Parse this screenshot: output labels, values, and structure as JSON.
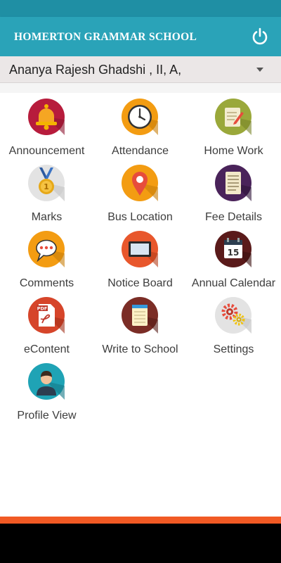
{
  "app": {
    "title": "HOMERTON GRAMMAR SCHOOL"
  },
  "student_selector": {
    "selected": "Ananya Rajesh Ghadshi , II, A,"
  },
  "menu": [
    {
      "label": "Announcement",
      "icon": "bell-icon"
    },
    {
      "label": "Attendance",
      "icon": "clock-icon"
    },
    {
      "label": "Home Work",
      "icon": "notepad-pencil-icon"
    },
    {
      "label": "Marks",
      "icon": "medal-icon"
    },
    {
      "label": "Bus Location",
      "icon": "map-pin-icon"
    },
    {
      "label": "Fee Details",
      "icon": "receipt-icon"
    },
    {
      "label": "Comments",
      "icon": "speech-bubble-icon"
    },
    {
      "label": "Notice Board",
      "icon": "screen-board-icon"
    },
    {
      "label": "Annual Calendar",
      "icon": "calendar-icon"
    },
    {
      "label": "eContent",
      "icon": "pdf-icon"
    },
    {
      "label": "Write to School",
      "icon": "notebook-icon"
    },
    {
      "label": "Settings",
      "icon": "gears-icon"
    },
    {
      "label": "Profile View",
      "icon": "user-avatar-icon"
    }
  ],
  "calendar_day": "15",
  "pdf_text": "PDF",
  "colors": {
    "app_bar": "#2aa3b8",
    "status_bar": "#1f8fa4",
    "accent": "#f15a24",
    "selector_bg": "#ebe7e7"
  }
}
